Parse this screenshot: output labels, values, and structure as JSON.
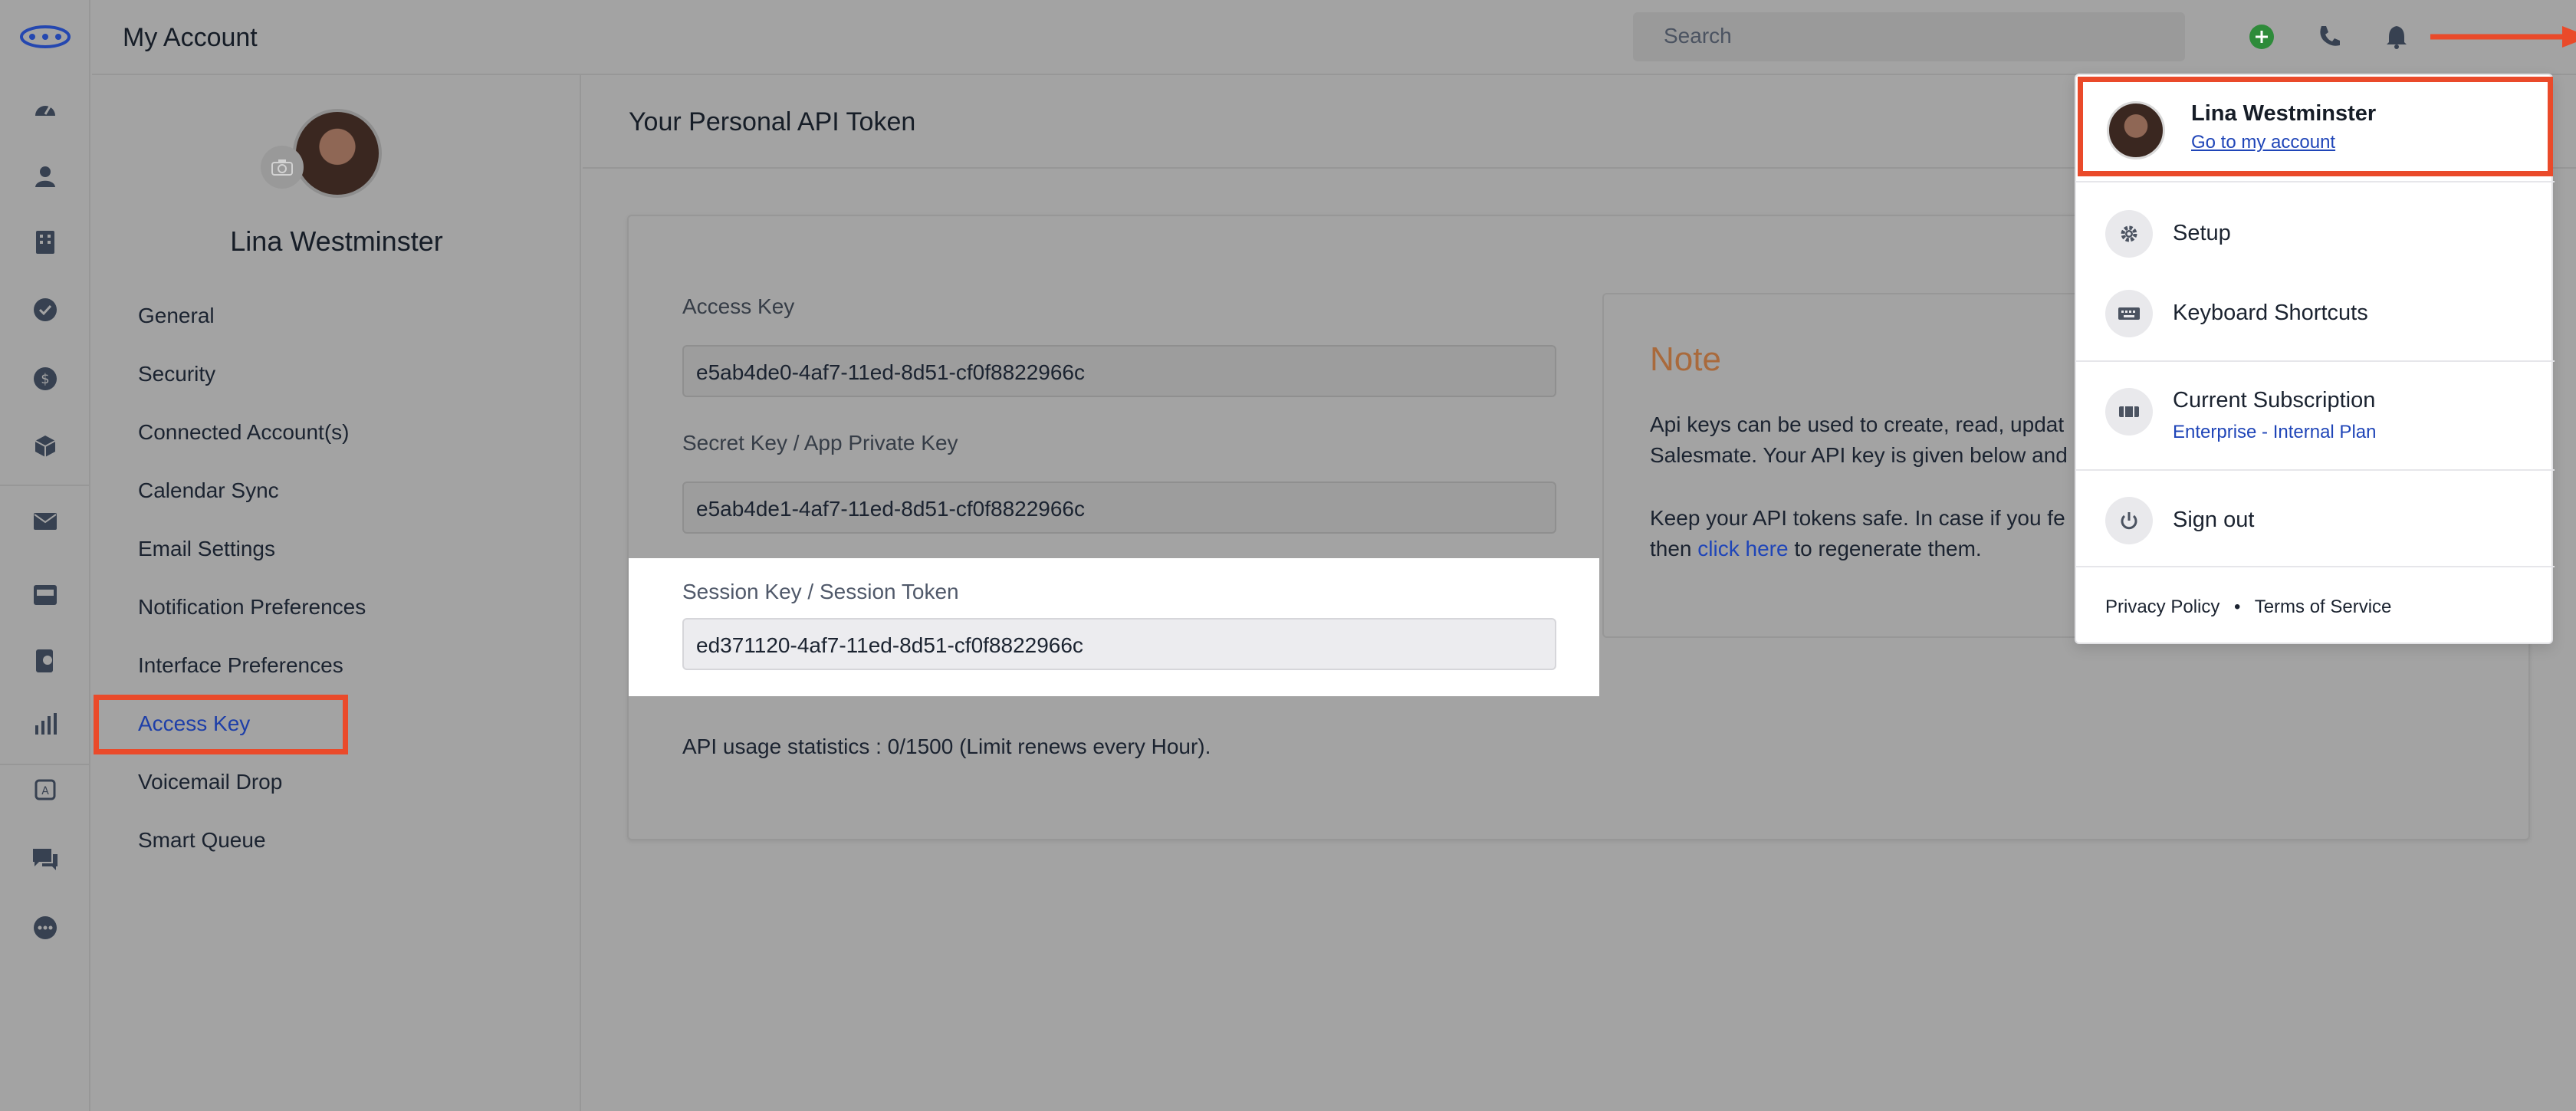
{
  "header": {
    "title": "My Account",
    "search_placeholder": "Search"
  },
  "profile": {
    "name": "Lina Westminster"
  },
  "sidebar": {
    "items": [
      {
        "label": "General"
      },
      {
        "label": "Security"
      },
      {
        "label": "Connected Account(s)"
      },
      {
        "label": "Calendar Sync"
      },
      {
        "label": "Email Settings"
      },
      {
        "label": "Notification Preferences"
      },
      {
        "label": "Interface Preferences"
      },
      {
        "label": "Access Key",
        "active": true
      },
      {
        "label": "Voicemail Drop"
      },
      {
        "label": "Smart Queue"
      }
    ]
  },
  "main": {
    "title": "Your Personal API Token",
    "access_key_label": "Access Key",
    "access_key_value": "e5ab4de0-4af7-11ed-8d51-cf0f8822966c",
    "secret_key_label": "Secret Key / App Private Key",
    "secret_key_value": "e5ab4de1-4af7-11ed-8d51-cf0f8822966c",
    "session_key_label": "Session Key / Session Token",
    "session_key_value": "ed371120-4af7-11ed-8d51-cf0f8822966c",
    "usage": "API usage statistics : 0/1500 (Limit renews every Hour)."
  },
  "note": {
    "title": "Note",
    "p1_line1": "Api keys can be used to create, read, updat",
    "p1_line2": "Salesmate. Your API key is given below and",
    "p2_line1": "Keep your API tokens safe. In case if you fe",
    "p2_line2_prefix": "then ",
    "p2_link": "click here",
    "p2_line2_suffix": " to regenerate them."
  },
  "dropdown": {
    "user_name": "Lina Westminster",
    "account_link": "Go to my account",
    "setup": "Setup",
    "keyboard_shortcuts": "Keyboard Shortcuts",
    "subscription": "Current Subscription",
    "plan": "Enterprise - Internal Plan",
    "sign_out": "Sign out",
    "privacy": "Privacy Policy",
    "bullet": "•",
    "terms": "Terms of Service"
  },
  "colors": {
    "highlight": "#ea4a2a",
    "link": "#1f45b8",
    "note_title": "#a96a3c",
    "add_button": "#2e8b3a"
  },
  "icons": [
    "logo-icon",
    "dashboard-icon",
    "contacts-icon",
    "companies-icon",
    "tasks-icon",
    "deals-icon",
    "products-icon",
    "email-icon",
    "inbox-icon",
    "phone-book-icon",
    "reports-icon",
    "automation-icon",
    "chat-icon",
    "more-icon",
    "add-icon",
    "phone-icon",
    "bell-icon",
    "camera-icon",
    "gear-icon",
    "keyboard-icon",
    "subscription-icon",
    "power-icon"
  ]
}
